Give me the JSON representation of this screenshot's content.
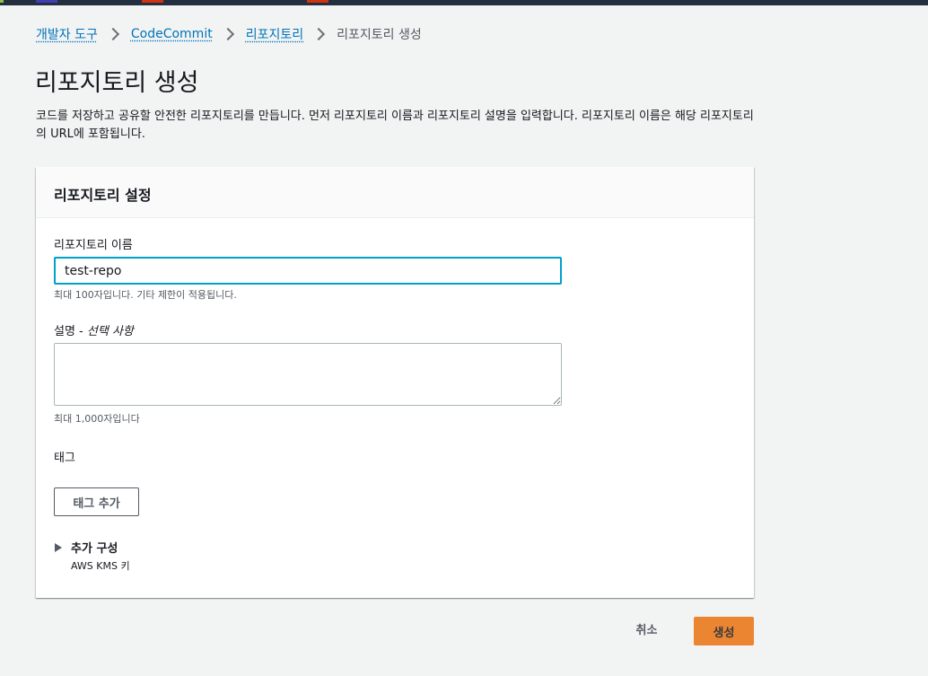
{
  "breadcrumb": {
    "items": [
      "개발자 도구",
      "CodeCommit",
      "리포지토리"
    ],
    "current": "리포지토리 생성"
  },
  "page": {
    "title": "리포지토리 생성",
    "description": "코드를 저장하고 공유할 안전한 리포지토리를 만듭니다. 먼저 리포지토리 이름과 리포지토리 설명을 입력합니다. 리포지토리 이름은 해당 리포지토리의 URL에 포함됩니다."
  },
  "panel": {
    "title": "리포지토리 설정",
    "name_label": "리포지토리 이름",
    "name_value": "test-repo",
    "name_hint": "최대 100자입니다. 기타 제한이 적용됩니다.",
    "description_label": "설명 -",
    "description_optional": "선택 사항",
    "description_value": "",
    "description_hint": "최대 1,000자입니다",
    "tags_label": "태그",
    "add_tag_label": "태그 추가",
    "advanced_title": "추가 구성",
    "advanced_subtitle": "AWS KMS 키"
  },
  "actions": {
    "cancel_label": "취소",
    "create_label": "생성"
  },
  "colors": {
    "background": "#f2f3f3",
    "link": "#0073bb",
    "focus_border": "#00a1c9",
    "primary_button": "#ec7211",
    "top_strip": "#232f3e",
    "top_marks": [
      "#8bc34a",
      "#3f3fb5",
      "#d13212",
      "#d13212"
    ]
  }
}
